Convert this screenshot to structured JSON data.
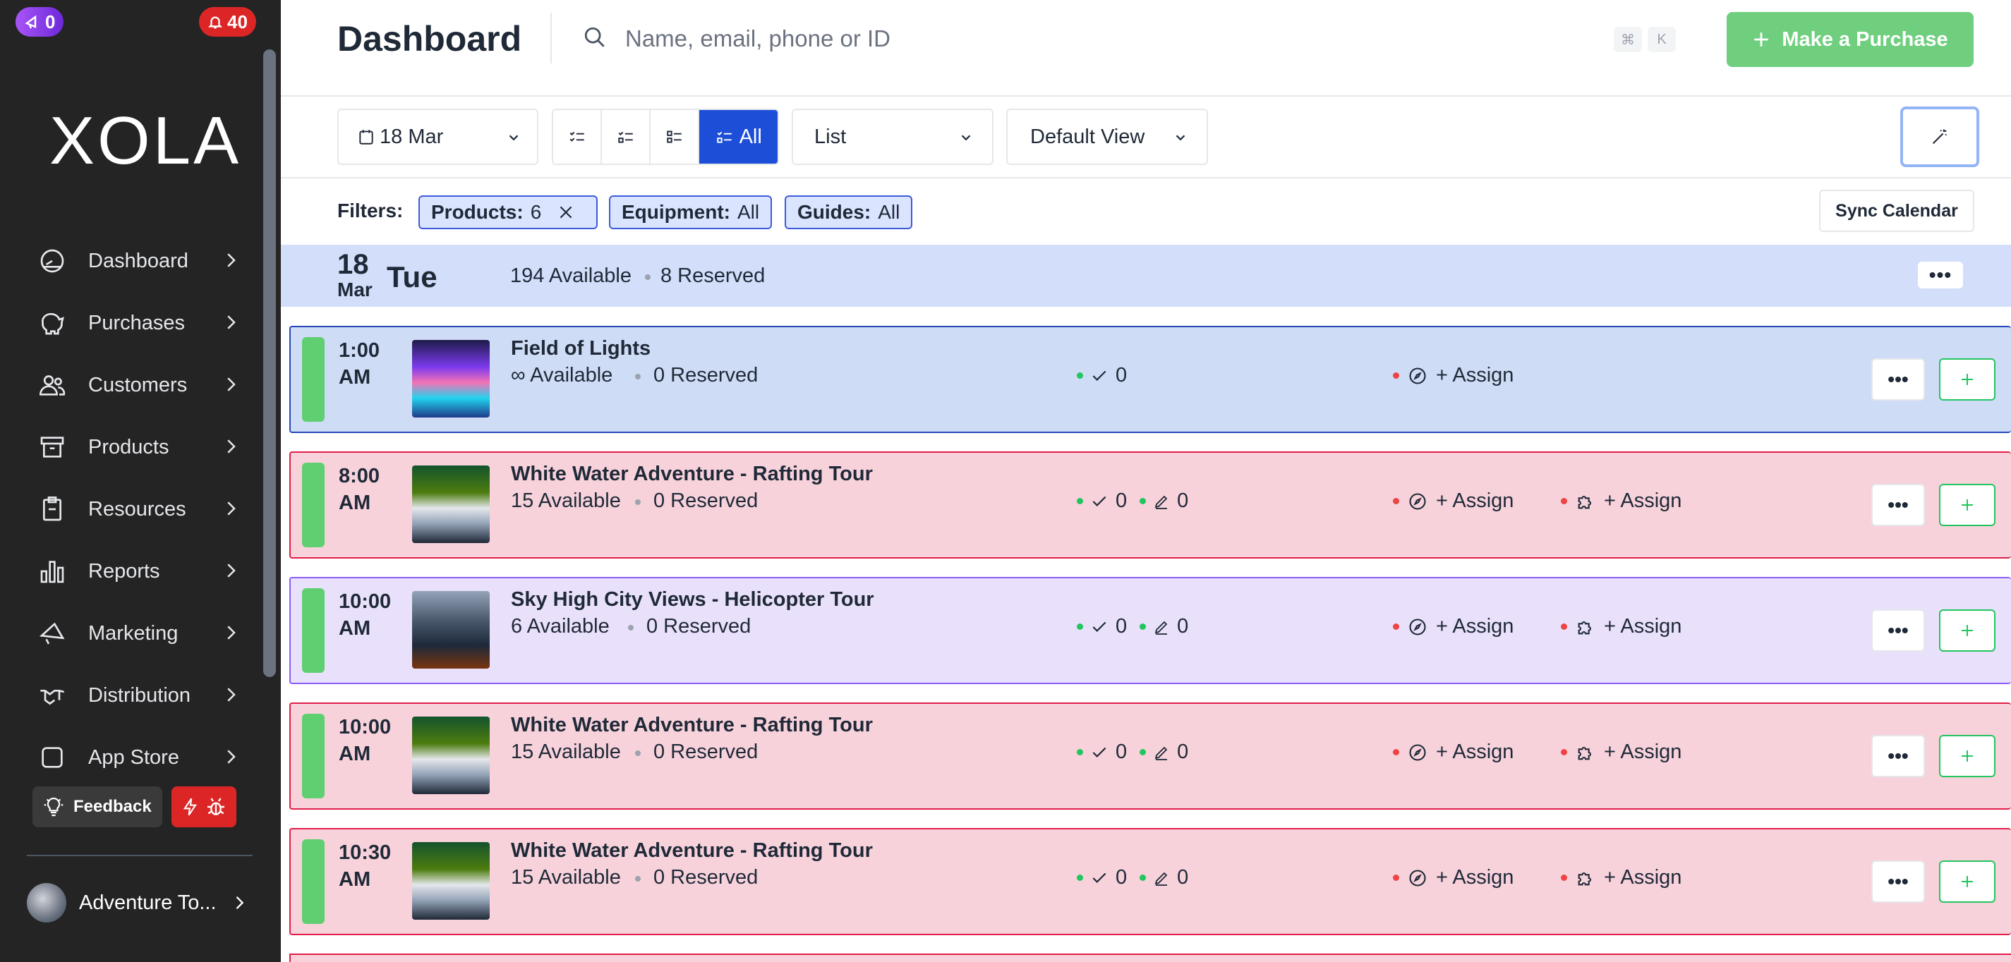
{
  "sidebar": {
    "badge_left": "0",
    "badge_right": "40",
    "logo": "XOLA",
    "items": [
      {
        "label": "Dashboard",
        "icon": "speedometer-icon"
      },
      {
        "label": "Purchases",
        "icon": "piggy-bank-icon"
      },
      {
        "label": "Customers",
        "icon": "users-icon"
      },
      {
        "label": "Products",
        "icon": "archive-box-icon"
      },
      {
        "label": "Resources",
        "icon": "clipboard-icon"
      },
      {
        "label": "Reports",
        "icon": "bar-chart-icon"
      },
      {
        "label": "Marketing",
        "icon": "megaphone-icon"
      },
      {
        "label": "Distribution",
        "icon": "handshake-icon"
      },
      {
        "label": "App Store",
        "icon": "app-square-icon"
      }
    ],
    "feedback_label": "Feedback",
    "account_name": "Adventure To..."
  },
  "header": {
    "title": "Dashboard",
    "search_placeholder": "Name, email, phone or ID",
    "kbd_cmd": "⌘",
    "kbd_key": "K",
    "purchase_button": "Make a Purchase"
  },
  "toolbar": {
    "date_value": "18 Mar",
    "filter_all_label": "All",
    "view_value": "List",
    "preset_value": "Default View"
  },
  "filters": {
    "label": "Filters:",
    "products_key": "Products:",
    "products_value": "6",
    "equipment_key": "Equipment:",
    "equipment_value": "All",
    "guides_key": "Guides:",
    "guides_value": "All",
    "sync_label": "Sync Calendar"
  },
  "day": {
    "date_num": "18",
    "month": "Mar",
    "weekday": "Tue",
    "available": "194 Available",
    "reserved": "8 Reserved",
    "more": "•••"
  },
  "rows": [
    {
      "time_h": "1:00",
      "time_ampm": "AM",
      "name": "Field of Lights",
      "available": "∞ Available",
      "reserved": "0 Reserved",
      "checked": "0",
      "assign_guide": "+ Assign"
    },
    {
      "time_h": "8:00",
      "time_ampm": "AM",
      "name": "White Water Adventure - Rafting Tour",
      "available": "15 Available",
      "reserved": "0 Reserved",
      "checked": "0",
      "edited": "0",
      "assign_guide": "+ Assign",
      "assign_equip": "+ Assign"
    },
    {
      "time_h": "10:00",
      "time_ampm": "AM",
      "name": "Sky High City Views - Helicopter Tour",
      "available": "6 Available",
      "reserved": "0 Reserved",
      "checked": "0",
      "edited": "0",
      "assign_guide": "+ Assign",
      "assign_equip": "+ Assign"
    },
    {
      "time_h": "10:00",
      "time_ampm": "AM",
      "name": "White Water Adventure - Rafting Tour",
      "available": "15 Available",
      "reserved": "0 Reserved",
      "checked": "0",
      "edited": "0",
      "assign_guide": "+ Assign",
      "assign_equip": "+ Assign"
    },
    {
      "time_h": "10:30",
      "time_ampm": "AM",
      "name": "White Water Adventure - Rafting Tour",
      "available": "15 Available",
      "reserved": "0 Reserved",
      "checked": "0",
      "edited": "0",
      "assign_guide": "+ Assign",
      "assign_equip": "+ Assign"
    }
  ],
  "colors": {
    "sidebar_bg": "#242424",
    "accent": "#1d4ed8",
    "success": "#6fcf7f",
    "danger": "#dc2626"
  }
}
